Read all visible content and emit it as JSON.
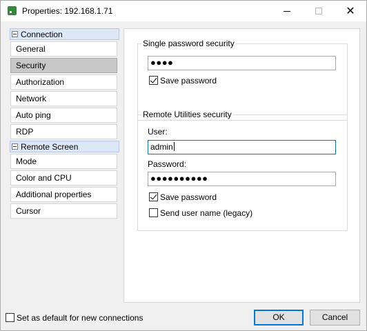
{
  "window": {
    "title": "Properties: 192.168.1.71",
    "minimize_icon": "minimize-icon",
    "maximize_icon": "maximize-icon",
    "close_icon": "close-icon",
    "close_glyph": "✕"
  },
  "sidebar": {
    "groups": [
      {
        "label": "Connection",
        "items": [
          "General",
          "Security",
          "Authorization",
          "Network",
          "Auto ping",
          "RDP"
        ]
      },
      {
        "label": "Remote Screen",
        "items": [
          "Mode",
          "Color and CPU",
          "Additional properties",
          "Cursor"
        ]
      }
    ],
    "selected": "Security"
  },
  "single_password": {
    "legend": "Single password security",
    "password_value": "●●●●",
    "save_password_label": "Save password",
    "save_password_checked": true
  },
  "remote_utilities": {
    "legend": "Remote Utilities security",
    "user_label": "User:",
    "user_value": "admin",
    "password_label": "Password:",
    "password_value": "●●●●●●●●●●",
    "save_password_label": "Save password",
    "save_password_checked": true,
    "send_user_label": "Send user name (legacy)",
    "send_user_checked": false
  },
  "footer": {
    "default_label": "Set as default for new connections",
    "default_checked": false,
    "ok_label": "OK",
    "cancel_label": "Cancel"
  },
  "colors": {
    "accent": "#0078d7",
    "group_bg": "#dde8f6",
    "selected_bg": "#c8c8c8"
  }
}
